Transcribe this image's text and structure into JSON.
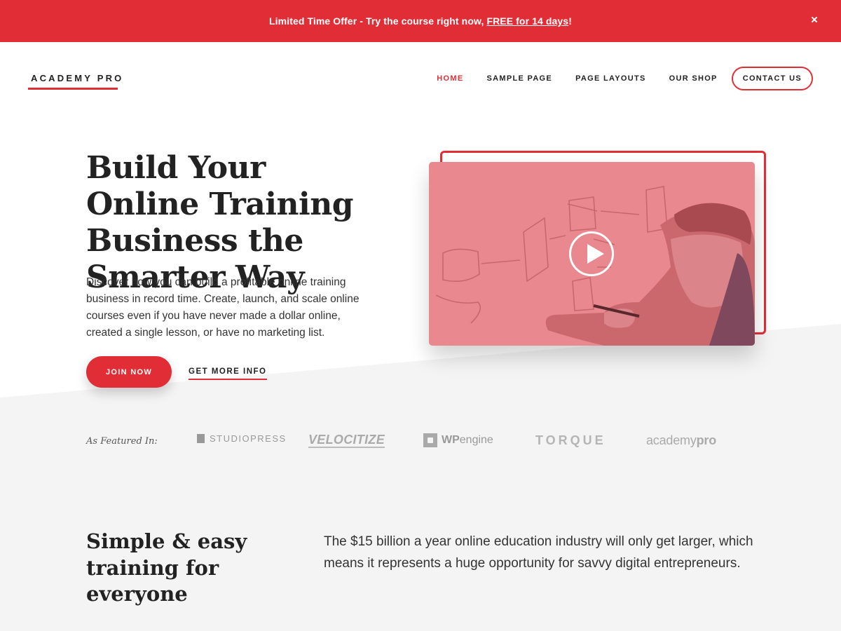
{
  "promo": {
    "text": "Limited Time Offer - Try the course right now,",
    "link": "FREE for 14 days",
    "suffix": "!",
    "close_icon": "close-icon"
  },
  "header": {
    "logo": "ACADEMY PRO",
    "nav": [
      "HOME",
      "SAMPLE PAGE",
      "PAGE LAYOUTS",
      "OUR SHOP",
      "CONTACT US"
    ],
    "active_nav": "HOME"
  },
  "hero": {
    "title": "Build Your Online Training Business the Smarter Way",
    "description": "Discover how you can build a profitable online training business in record time. Create, launch, and scale online courses even if you have never made a dollar online, created a single lesson, or have no marketing list.",
    "join_label": "JOIN NOW",
    "info_label": "GET MORE INFO",
    "video_icon": "play-icon"
  },
  "featured": {
    "label": "As Featured In:",
    "brands": [
      "STUDIOPRESS",
      "VELOCITIZE",
      "WP",
      "engine",
      "TORQUE",
      "academy",
      "pro"
    ]
  },
  "intro": {
    "title": "Simple & easy training for everyone",
    "text": "The $15 billion a year online education industry will only get larger, which means it represents a huge opportunity for savvy digital entrepreneurs."
  },
  "colors": {
    "accent": "#e12e36",
    "grey_background": "#f4f4f4"
  }
}
